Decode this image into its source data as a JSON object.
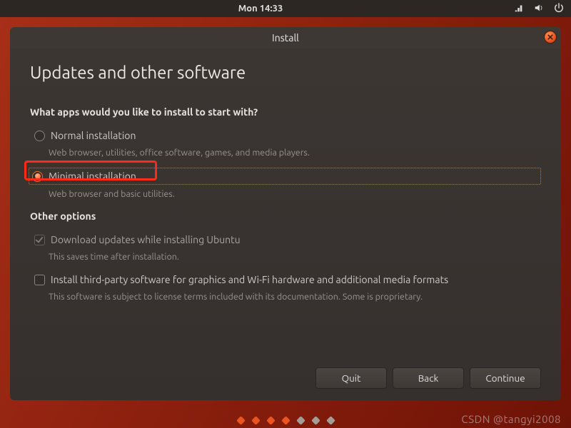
{
  "menubar": {
    "datetime": "Mon 14:33"
  },
  "window": {
    "title": "Install",
    "page_heading": "Updates and other software"
  },
  "section1": {
    "question": "What apps would you like to install to start with?",
    "normal": {
      "label": "Normal installation",
      "desc": "Web browser, utilities, office software, games, and media players."
    },
    "minimal": {
      "label": "Minimal installation",
      "desc": "Web browser and basic utilities."
    }
  },
  "section2": {
    "heading": "Other options",
    "download": {
      "label": "Download updates while installing Ubuntu",
      "desc": "This saves time after installation."
    },
    "thirdparty": {
      "label": "Install third-party software for graphics and Wi-Fi hardware and additional media formats",
      "desc": "This software is subject to license terms included with its documentation. Some is proprietary."
    }
  },
  "buttons": {
    "quit": "Quit",
    "back": "Back",
    "continue": "Continue"
  },
  "pager": {
    "total": 7,
    "done": 4
  },
  "watermark": "CSDN @tangyi2008"
}
